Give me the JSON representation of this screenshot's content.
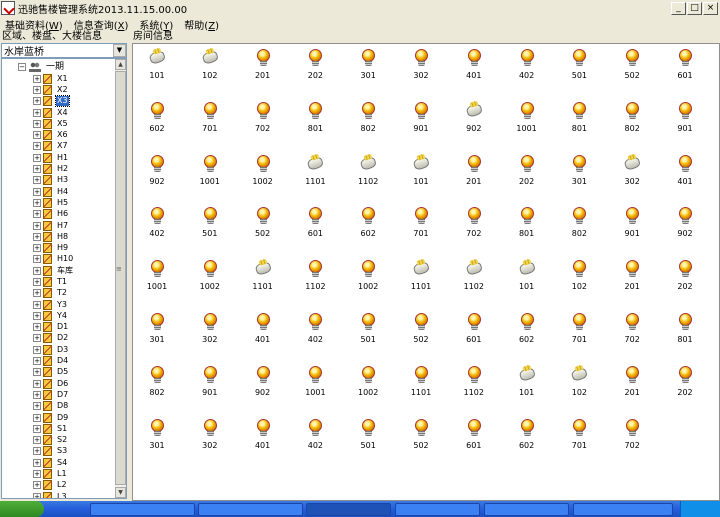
{
  "window": {
    "title": "迅驰售楼管理系统2013.11.15.00.00"
  },
  "window_buttons": [
    "_",
    "□",
    "×"
  ],
  "menu": [
    {
      "label": "基础资料",
      "key": "W"
    },
    {
      "label": "信息查询",
      "key": "X"
    },
    {
      "label": "系统",
      "key": "Y"
    },
    {
      "label": "帮助",
      "key": "Z"
    }
  ],
  "left_panel": {
    "header": "区域、楼盘、大楼信息",
    "selector_value": "水岸蓝桥"
  },
  "tree": {
    "root": "一期",
    "items": [
      "X1",
      "X2",
      "X3",
      "X4",
      "X5",
      "X6",
      "X7",
      "H1",
      "H2",
      "H3",
      "H4",
      "H5",
      "H6",
      "H7",
      "H8",
      "H9",
      "H10",
      "车库",
      "T1",
      "T2",
      "Y3",
      "Y4",
      "D1",
      "D2",
      "D3",
      "D4",
      "D5",
      "D6",
      "D7",
      "D8",
      "D9",
      "S1",
      "S2",
      "S3",
      "S4",
      "L1",
      "L2",
      "L3"
    ],
    "selected": "X3"
  },
  "right_panel": {
    "header": "房间信息"
  },
  "rooms": [
    {
      "no": "101",
      "state": "off"
    },
    {
      "no": "102",
      "state": "off"
    },
    {
      "no": "201",
      "state": "on"
    },
    {
      "no": "202",
      "state": "on"
    },
    {
      "no": "301",
      "state": "on"
    },
    {
      "no": "302",
      "state": "on"
    },
    {
      "no": "401",
      "state": "on"
    },
    {
      "no": "402",
      "state": "on"
    },
    {
      "no": "501",
      "state": "on"
    },
    {
      "no": "502",
      "state": "on"
    },
    {
      "no": "601",
      "state": "on"
    },
    {
      "no": "602",
      "state": "on"
    },
    {
      "no": "701",
      "state": "on"
    },
    {
      "no": "702",
      "state": "on"
    },
    {
      "no": "801",
      "state": "on"
    },
    {
      "no": "802",
      "state": "on"
    },
    {
      "no": "901",
      "state": "on"
    },
    {
      "no": "902",
      "state": "off"
    },
    {
      "no": "1001",
      "state": "on"
    },
    {
      "no": "801",
      "state": "on"
    },
    {
      "no": "802",
      "state": "on"
    },
    {
      "no": "901",
      "state": "on"
    },
    {
      "no": "902",
      "state": "on"
    },
    {
      "no": "1001",
      "state": "on"
    },
    {
      "no": "1002",
      "state": "on"
    },
    {
      "no": "1101",
      "state": "off"
    },
    {
      "no": "1102",
      "state": "off"
    },
    {
      "no": "101",
      "state": "off"
    },
    {
      "no": "201",
      "state": "on"
    },
    {
      "no": "202",
      "state": "on"
    },
    {
      "no": "301",
      "state": "on"
    },
    {
      "no": "302",
      "state": "off"
    },
    {
      "no": "401",
      "state": "on"
    },
    {
      "no": "402",
      "state": "on"
    },
    {
      "no": "501",
      "state": "on"
    },
    {
      "no": "502",
      "state": "on"
    },
    {
      "no": "601",
      "state": "on"
    },
    {
      "no": "602",
      "state": "on"
    },
    {
      "no": "701",
      "state": "on"
    },
    {
      "no": "702",
      "state": "on"
    },
    {
      "no": "801",
      "state": "on"
    },
    {
      "no": "802",
      "state": "on"
    },
    {
      "no": "901",
      "state": "on"
    },
    {
      "no": "902",
      "state": "on"
    },
    {
      "no": "1001",
      "state": "on"
    },
    {
      "no": "1002",
      "state": "on"
    },
    {
      "no": "1101",
      "state": "off"
    },
    {
      "no": "1102",
      "state": "on"
    },
    {
      "no": "1002",
      "state": "on"
    },
    {
      "no": "1101",
      "state": "off"
    },
    {
      "no": "1102",
      "state": "off"
    },
    {
      "no": "101",
      "state": "off"
    },
    {
      "no": "102",
      "state": "on"
    },
    {
      "no": "201",
      "state": "on"
    },
    {
      "no": "202",
      "state": "on"
    },
    {
      "no": "301",
      "state": "on"
    },
    {
      "no": "302",
      "state": "on"
    },
    {
      "no": "401",
      "state": "on"
    },
    {
      "no": "402",
      "state": "on"
    },
    {
      "no": "501",
      "state": "on"
    },
    {
      "no": "502",
      "state": "on"
    },
    {
      "no": "601",
      "state": "on"
    },
    {
      "no": "602",
      "state": "on"
    },
    {
      "no": "701",
      "state": "on"
    },
    {
      "no": "702",
      "state": "on"
    },
    {
      "no": "801",
      "state": "on"
    },
    {
      "no": "802",
      "state": "on"
    },
    {
      "no": "901",
      "state": "on"
    },
    {
      "no": "902",
      "state": "on"
    },
    {
      "no": "1001",
      "state": "on"
    },
    {
      "no": "1002",
      "state": "on"
    },
    {
      "no": "1101",
      "state": "on"
    },
    {
      "no": "1102",
      "state": "on"
    },
    {
      "no": "101",
      "state": "off"
    },
    {
      "no": "102",
      "state": "off"
    },
    {
      "no": "201",
      "state": "on"
    },
    {
      "no": "202",
      "state": "on"
    },
    {
      "no": "301",
      "state": "on"
    },
    {
      "no": "302",
      "state": "on"
    },
    {
      "no": "401",
      "state": "on"
    },
    {
      "no": "402",
      "state": "on"
    },
    {
      "no": "501",
      "state": "on"
    },
    {
      "no": "502",
      "state": "on"
    },
    {
      "no": "601",
      "state": "on"
    },
    {
      "no": "602",
      "state": "on"
    },
    {
      "no": "701",
      "state": "on"
    },
    {
      "no": "702",
      "state": "on"
    }
  ]
}
